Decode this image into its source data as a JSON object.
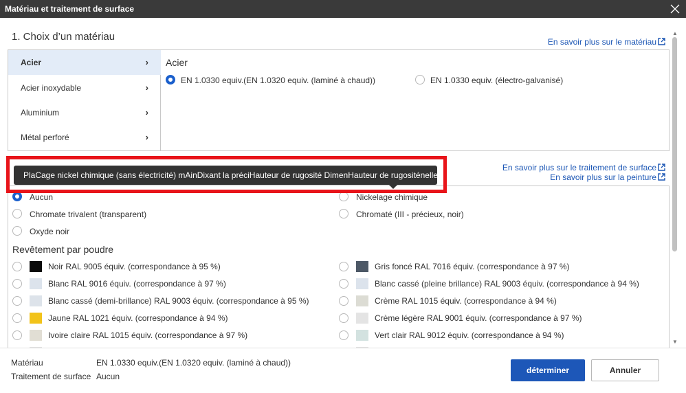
{
  "window": {
    "title": "Matériau et traitement de surface"
  },
  "material": {
    "section_title": "1. Choix d’un matériau",
    "learn_more": "En savoir plus sur le matériau",
    "categories": [
      {
        "label": "Acier",
        "selected": true
      },
      {
        "label": "Acier inoxydable",
        "selected": false
      },
      {
        "label": "Aluminium",
        "selected": false
      },
      {
        "label": "Métal perforé",
        "selected": false
      }
    ],
    "chevron": "›",
    "panel_title": "Acier",
    "options": [
      {
        "label": "EN 1.0330 equiv.(EN 1.0320 equiv. (laminé à chaud))",
        "selected": true
      },
      {
        "label": "EN 1.0330 equiv. (électro-galvanisé)",
        "selected": false
      }
    ]
  },
  "surface": {
    "learn_more_treatment": "En savoir plus sur le traitement de surface",
    "learn_more_paint": "En savoir plus sur la peinture",
    "options_left": [
      {
        "label": "Aucun",
        "selected": true
      },
      {
        "label": "Chromate trivalent (transparent)",
        "selected": false
      },
      {
        "label": "Oxyde noir",
        "selected": false
      }
    ],
    "options_right": [
      {
        "label": "Nickelage chimique",
        "selected": false
      },
      {
        "label": "Chromaté (III - précieux, noir)",
        "selected": false
      }
    ],
    "powder_title": "Revêtement par poudre",
    "powder_left": [
      {
        "label": "Noir RAL 9005 équiv. (correspondance à 95 %)",
        "color": "#0a0a0a"
      },
      {
        "label": "Blanc RAL 9016 équiv. (correspondance à 97 %)",
        "color": "#dce3ec"
      },
      {
        "label": "Blanc cassé (demi-brillance) RAL 9003 équiv. (correspondance à 95 %)",
        "color": "#dde3ea"
      },
      {
        "label": "Jaune RAL 1021 équiv. (correspondance à 94 %)",
        "color": "#f2c31a"
      },
      {
        "label": "Ivoire claire RAL 1015 équiv. (correspondance à 97 %)",
        "color": "#e1ded4"
      }
    ],
    "powder_right": [
      {
        "label": "Gris foncé RAL 7016 équiv. (correspondance à 97 %)",
        "color": "#4d5866"
      },
      {
        "label": "Blanc cassé (pleine brillance) RAL 9003 équiv. (correspondance à 94 %)",
        "color": "#dce3ec"
      },
      {
        "label": "Crème RAL 1015 équiv. (correspondance à 94 %)",
        "color": "#dcdcd4"
      },
      {
        "label": "Crème légère RAL 9001 équiv. (correspondance à 97 %)",
        "color": "#e4e4e4"
      },
      {
        "label": "Vert clair RAL 9012 équiv. (correspondance à 94 %)",
        "color": "#d3e2e0"
      }
    ]
  },
  "tooltip": {
    "text": "PlaCage nickel chimique (sans électricité) mAinDixant la préciHauteur de rugosité DimenHauteur de rugositénelle"
  },
  "footer": {
    "material_label": "Matériau",
    "material_value": "EN 1.0330 equiv.(EN 1.0320 equiv. (laminé à chaud))",
    "surface_label": "Traitement de surface",
    "surface_value": "Aucun",
    "confirm_label": "déterminer",
    "cancel_label": "Annuler"
  },
  "colors": {
    "accent": "#1d57b8",
    "link": "#1a55b4",
    "highlight": "#e8141a"
  }
}
